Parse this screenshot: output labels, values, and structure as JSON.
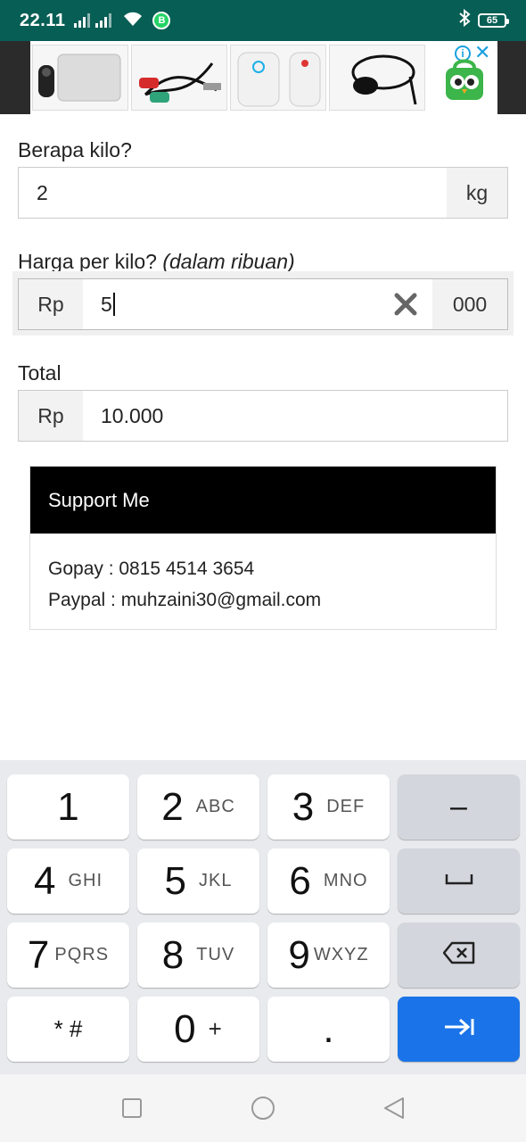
{
  "status_bar": {
    "time": "22.11",
    "battery_level": "65",
    "whatsapp_badge": "B"
  },
  "ad": {
    "info_symbol": "i",
    "close_symbol": "✕"
  },
  "form": {
    "weight": {
      "label": "Berapa kilo?",
      "value": "2",
      "unit": "kg"
    },
    "price": {
      "label": "Harga per kilo?",
      "label_hint": "(dalam ribuan)",
      "prefix": "Rp",
      "value": "5",
      "suffix": "000"
    },
    "total": {
      "label": "Total",
      "prefix": "Rp",
      "value": "10.000"
    }
  },
  "support": {
    "title": "Support Me",
    "gopay": "Gopay : 0815 4514 3654",
    "paypal": "Paypal : muhzaini30@gmail.com"
  },
  "keyboard": {
    "keys": [
      {
        "main": "1",
        "sub": ""
      },
      {
        "main": "2",
        "sub": "ABC"
      },
      {
        "main": "3",
        "sub": "DEF"
      },
      {
        "main": "4",
        "sub": "GHI"
      },
      {
        "main": "5",
        "sub": "JKL"
      },
      {
        "main": "6",
        "sub": "MNO"
      },
      {
        "main": "7",
        "sub": "PQRS"
      },
      {
        "main": "8",
        "sub": "TUV"
      },
      {
        "main": "9",
        "sub": "WXYZ"
      },
      {
        "main": "* #",
        "sub": ""
      },
      {
        "main": "0",
        "sub": "+"
      },
      {
        "main": ".",
        "sub": ""
      }
    ],
    "minus": "–"
  },
  "colors": {
    "status_bar": "#075e54",
    "enter_key": "#1a73e8",
    "card_header": "#000000"
  }
}
